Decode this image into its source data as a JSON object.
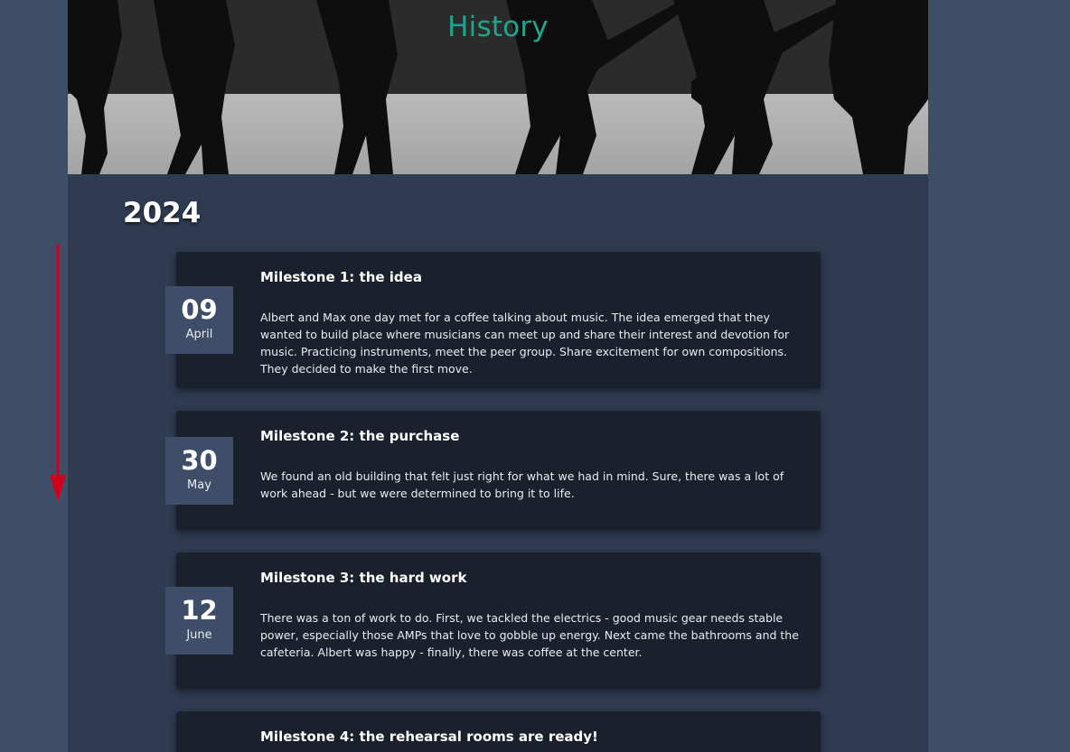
{
  "page": {
    "title": "History",
    "year": "2024"
  },
  "milestones": [
    {
      "day": "09",
      "month": "April",
      "title": "Milestone 1: the idea",
      "text": "Albert and Max one day met for a coffee talking about music. The idea emerged that they wanted to build place where musicians can meet up and share their interest and devotion for music. Practicing instruments, meet the peer group. Share excitement for own compositions. They decided to make the first move."
    },
    {
      "day": "30",
      "month": "May",
      "title": "Milestone 2: the purchase",
      "text": "We found an old building that felt just right for what we had in mind. Sure, there was a lot of work ahead - but we were determined to bring it to life."
    },
    {
      "day": "12",
      "month": "June",
      "title": "Milestone 3: the hard work",
      "text": "There was a ton of work to do. First, we tackled the electrics - good music gear needs stable power, especially those AMPs that love to gobble up energy. Next came the bathrooms and the cafeteria. Albert was happy - finally, there was coffee at the center."
    },
    {
      "day": "",
      "month": "",
      "title": "Milestone 4: the rehearsal rooms are ready!",
      "text": ""
    }
  ],
  "colors": {
    "outer_background": "#3f4d66",
    "content_background": "#2e3b50",
    "card_background": "#1a212c",
    "date_badge": "#3e4e68",
    "title_accent": "#1fa58f",
    "arrow": "#d0021b"
  },
  "icons": {
    "scroll_arrow": "arrow-down-icon"
  }
}
